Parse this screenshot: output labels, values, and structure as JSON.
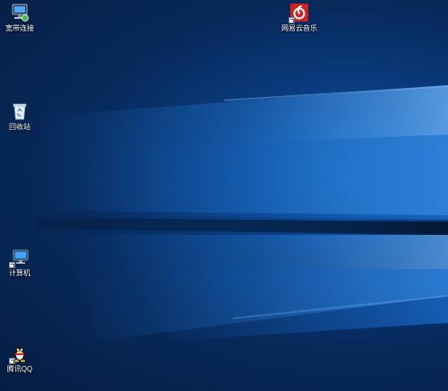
{
  "desktop": {
    "icons": [
      {
        "label": "宽带连接",
        "icon": "broadband-connection-icon"
      },
      {
        "label": "网易云音乐",
        "icon": "netease-music-icon"
      },
      {
        "label": "回收站",
        "icon": "recycle-bin-icon"
      },
      {
        "label": "计算机",
        "icon": "computer-icon"
      },
      {
        "label": "腾讯QQ",
        "icon": "qq-penguin-icon"
      }
    ],
    "colors": {
      "background_dark": "#051d42",
      "background_mid": "#0a3f86",
      "beam_light": "#2f8de6",
      "netease_red": "#d51f1f"
    }
  }
}
